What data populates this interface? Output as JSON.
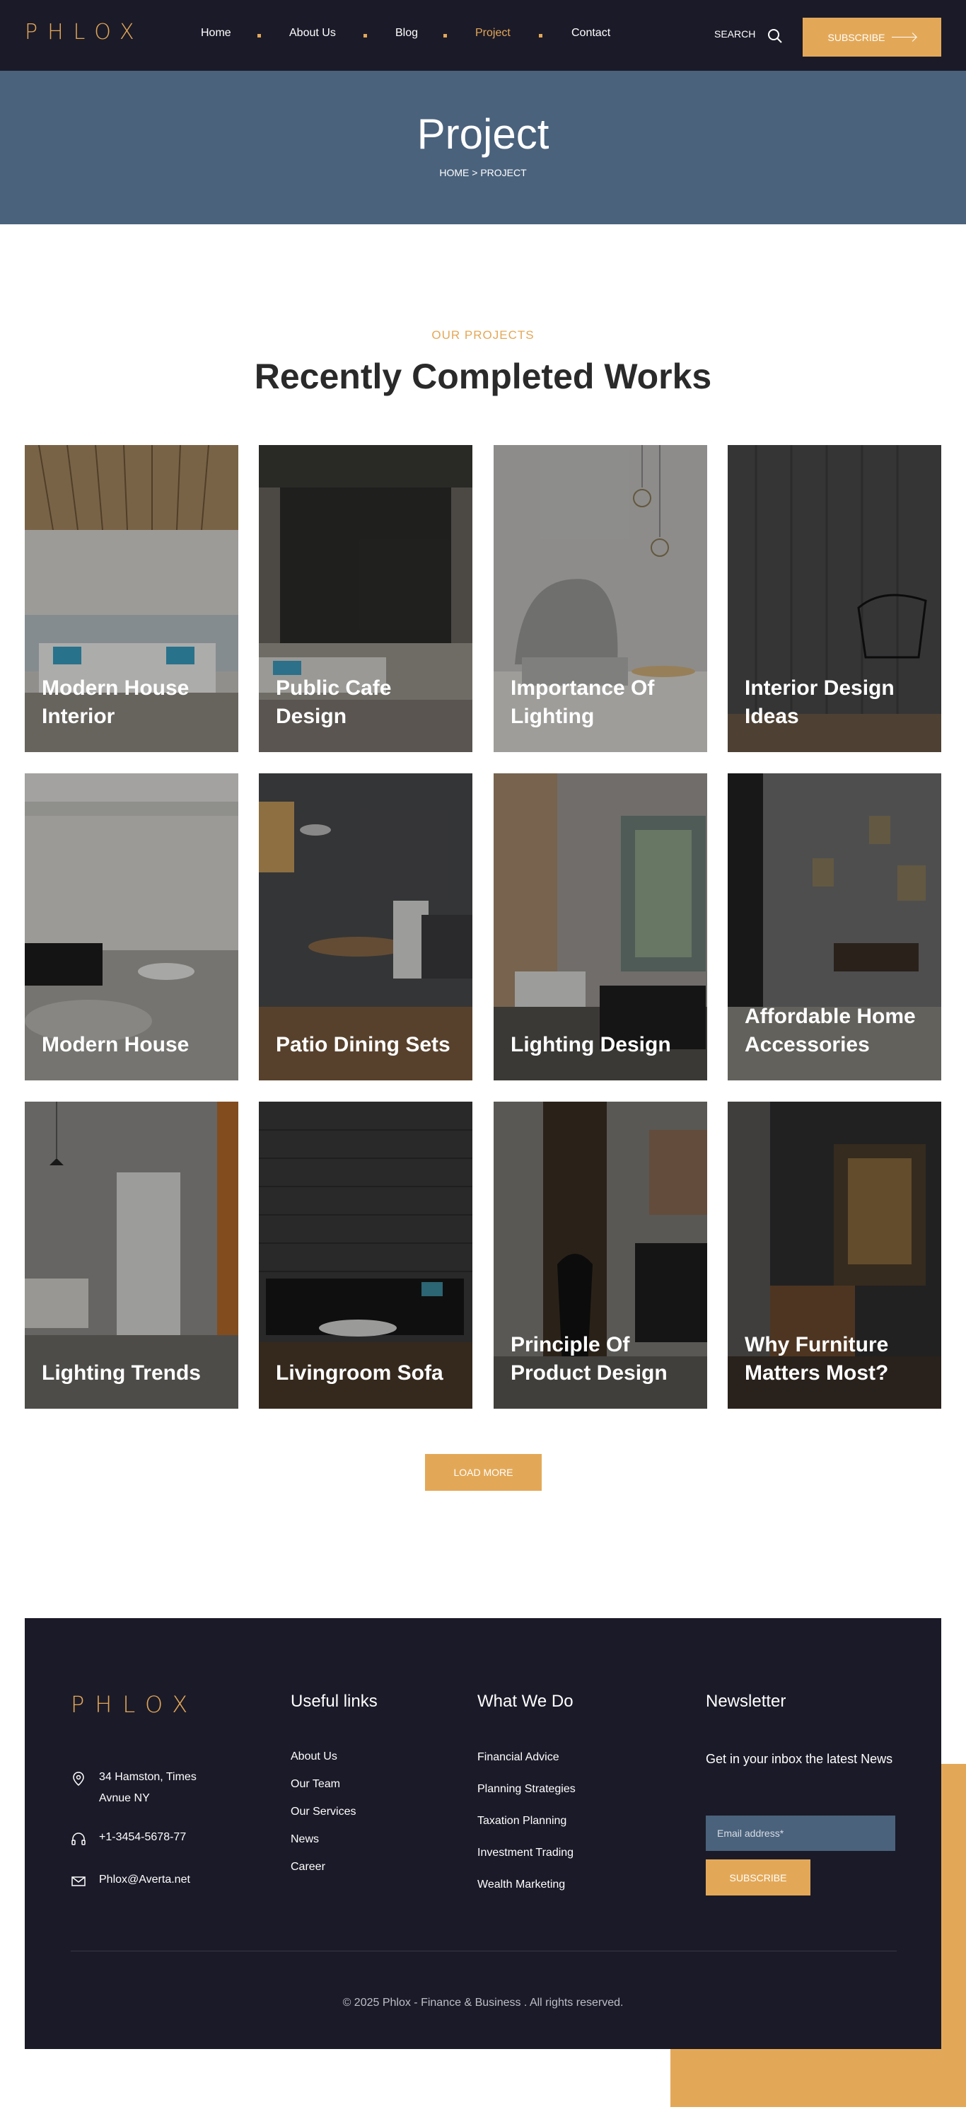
{
  "header": {
    "logo": "PHLOX",
    "nav": [
      {
        "label": "Home"
      },
      {
        "label": "About Us"
      },
      {
        "label": "Blog"
      },
      {
        "label": "Project"
      },
      {
        "label": "Contact"
      }
    ],
    "active_nav": "Project",
    "search_label": "SEARCH",
    "subscribe_label": "SUBSCRIBE"
  },
  "hero": {
    "title": "Project",
    "breadcrumb_home": "HOME",
    "breadcrumb_sep": ">",
    "breadcrumb_current": "PROJECT"
  },
  "section": {
    "eyebrow": "OUR PROJECTS",
    "title": "Recently Completed Works"
  },
  "projects": [
    {
      "title": "Modern House Interior"
    },
    {
      "title": "Public Cafe Design"
    },
    {
      "title": "Importance Of Lighting"
    },
    {
      "title": "Interior Design Ideas"
    },
    {
      "title": "Modern House"
    },
    {
      "title": "Patio Dining Sets"
    },
    {
      "title": "Lighting Design"
    },
    {
      "title": "Affordable Home Accessories"
    },
    {
      "title": "Lighting Trends"
    },
    {
      "title": "Livingroom Sofa"
    },
    {
      "title": "Principle Of Product Design"
    },
    {
      "title": "Why Furniture Matters Most?"
    }
  ],
  "load_more_label": "LOAD MORE",
  "footer": {
    "logo": "PHLOX",
    "address": "34 Hamston, Times Avnue NY",
    "phone": "+1-3454-5678-77",
    "email": "Phlox@Averta.net",
    "useful_links_heading": "Useful links",
    "useful_links": [
      "About Us",
      "Our Team",
      "Our Services",
      "News",
      "Career"
    ],
    "what_we_do_heading": "What We Do",
    "what_we_do": [
      "Financial Advice",
      "Planning Strategies",
      "Taxation Planning",
      "Investment Trading",
      "Wealth Marketing"
    ],
    "newsletter_heading": "Newsletter",
    "newsletter_text": "Get in your inbox the latest News",
    "email_placeholder": "Email address*",
    "subscribe_label": "SUBSCRIBE",
    "copyright": "© 2025 Phlox - Finance & Business . All rights reserved."
  },
  "colors": {
    "accent": "#e3a857",
    "dark": "#1b1a28",
    "hero": "#4a627c"
  }
}
